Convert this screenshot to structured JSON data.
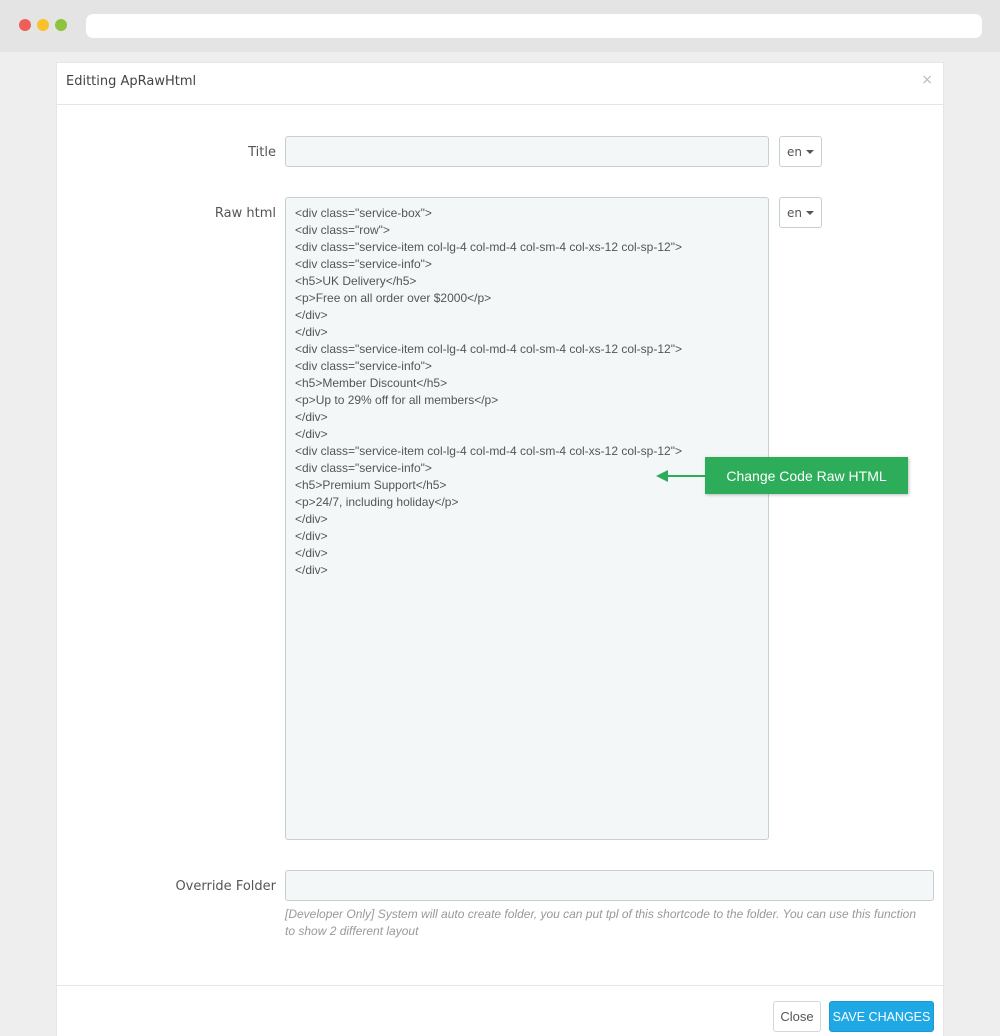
{
  "window": {
    "controls": [
      "close-dot",
      "minimize-dot",
      "maximize-dot"
    ],
    "colors": {
      "red": "#ef5f58",
      "yellow": "#f9c12c",
      "green": "#8cc43d"
    }
  },
  "modal": {
    "title": "Editting ApRawHtml",
    "close_icon": "×"
  },
  "form": {
    "title_label": "Title",
    "title_value": "",
    "title_lang": "en",
    "raw_html_label": "Raw html",
    "raw_html_lang": "en",
    "raw_html_lines": [
      "<div class=\"service-box\">",
      "<div class=\"row\">",
      "<div class=\"service-item col-lg-4 col-md-4 col-sm-4 col-xs-12 col-sp-12\">",
      "<div class=\"service-info\">",
      "<h5>UK Delivery</h5>",
      "<p>Free on all order over $2000</p>",
      "</div>",
      "</div>",
      "<div class=\"service-item col-lg-4 col-md-4 col-sm-4 col-xs-12 col-sp-12\">",
      "<div class=\"service-info\">",
      "<h5>Member Discount</h5>",
      "<p>Up to 29% off for all members</p>",
      "</div>",
      "</div>",
      "<div class=\"service-item col-lg-4 col-md-4 col-sm-4 col-xs-12 col-sp-12\">",
      "<div class=\"service-info\">",
      "<h5>Premium Support</h5>",
      "<p>24/7, including holiday</p>",
      "</div>",
      "</div>",
      "</div>",
      "</div>"
    ],
    "override_label": "Override Folder",
    "override_value": "",
    "override_help": "[Developer Only] System will auto create folder, you can put tpl of this shortcode to the folder. You can use this function to show 2 different layout"
  },
  "callout": {
    "text": "Change Code Raw HTML",
    "color": "#2dac5a"
  },
  "footer": {
    "close_label": "Close",
    "save_label": "SAVE CHANGES",
    "save_color": "#1fa8e6"
  }
}
